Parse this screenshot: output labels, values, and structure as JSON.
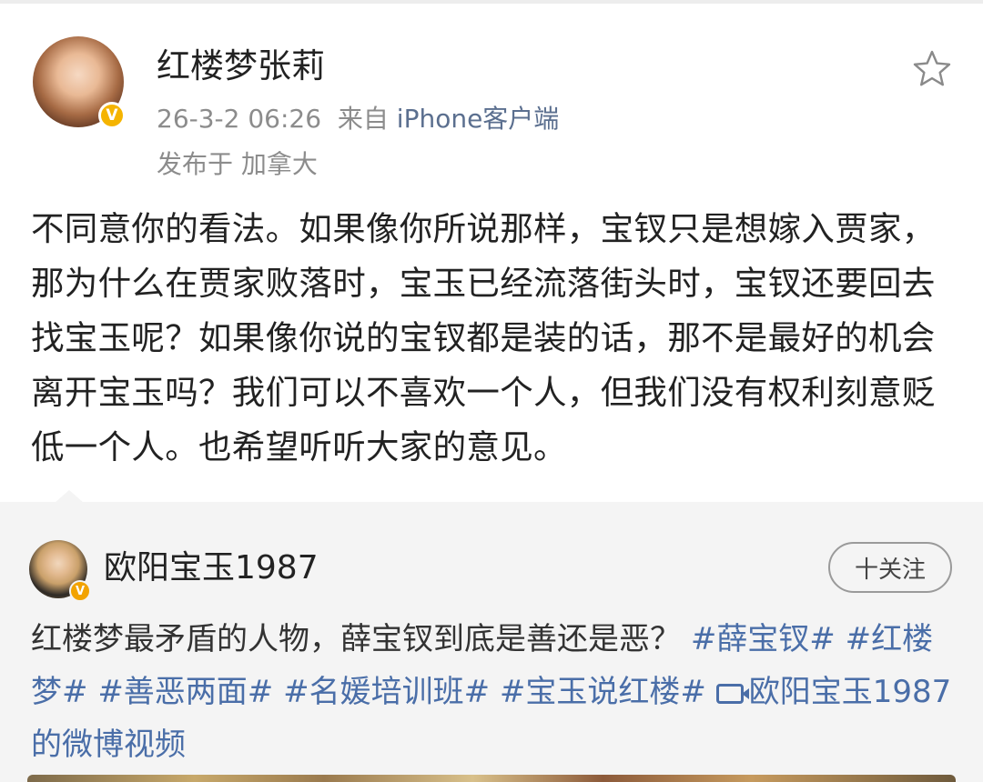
{
  "post": {
    "author": "红楼梦张莉",
    "date": "26-3-2 06:26",
    "source_prefix": "来自",
    "client": "iPhone客户端",
    "location_prefix": "发布于",
    "location": "加拿大",
    "body": "不同意你的看法。如果像你所说那样，宝钗只是想嫁入贾家，那为什么在贾家败落时，宝玉已经流落街头时，宝钗还要回去找宝玉呢？如果像你说的宝钗都是装的话，那不是最好的机会离开宝玉吗？我们可以不喜欢一个人，但我们没有权利刻意贬低一个人。也希望听听大家的意见。",
    "icons": {
      "avatar": "avatar-photo",
      "verified": "verified-badge-icon",
      "favorite": "star-icon"
    }
  },
  "repost": {
    "author": "欧阳宝玉1987",
    "follow_label": "十关注",
    "text_plain": "红楼梦最矛盾的人物，薛宝钗到底是善还是恶？",
    "tags": [
      "#薛宝钗#",
      "#红楼梦#",
      "#善恶两面#",
      "#名媛培训班#",
      "#宝玉说红楼#"
    ],
    "video_link": "欧阳宝玉1987的微博视频",
    "icons": {
      "avatar": "avatar-photo",
      "verified": "verified-badge-icon",
      "video": "video-camera-icon"
    }
  },
  "colors": {
    "link": "#4a6ea8",
    "meta_gray": "#8c8c8c",
    "verified_gold": "#f5b400",
    "repost_bg": "#f4f4f4"
  }
}
